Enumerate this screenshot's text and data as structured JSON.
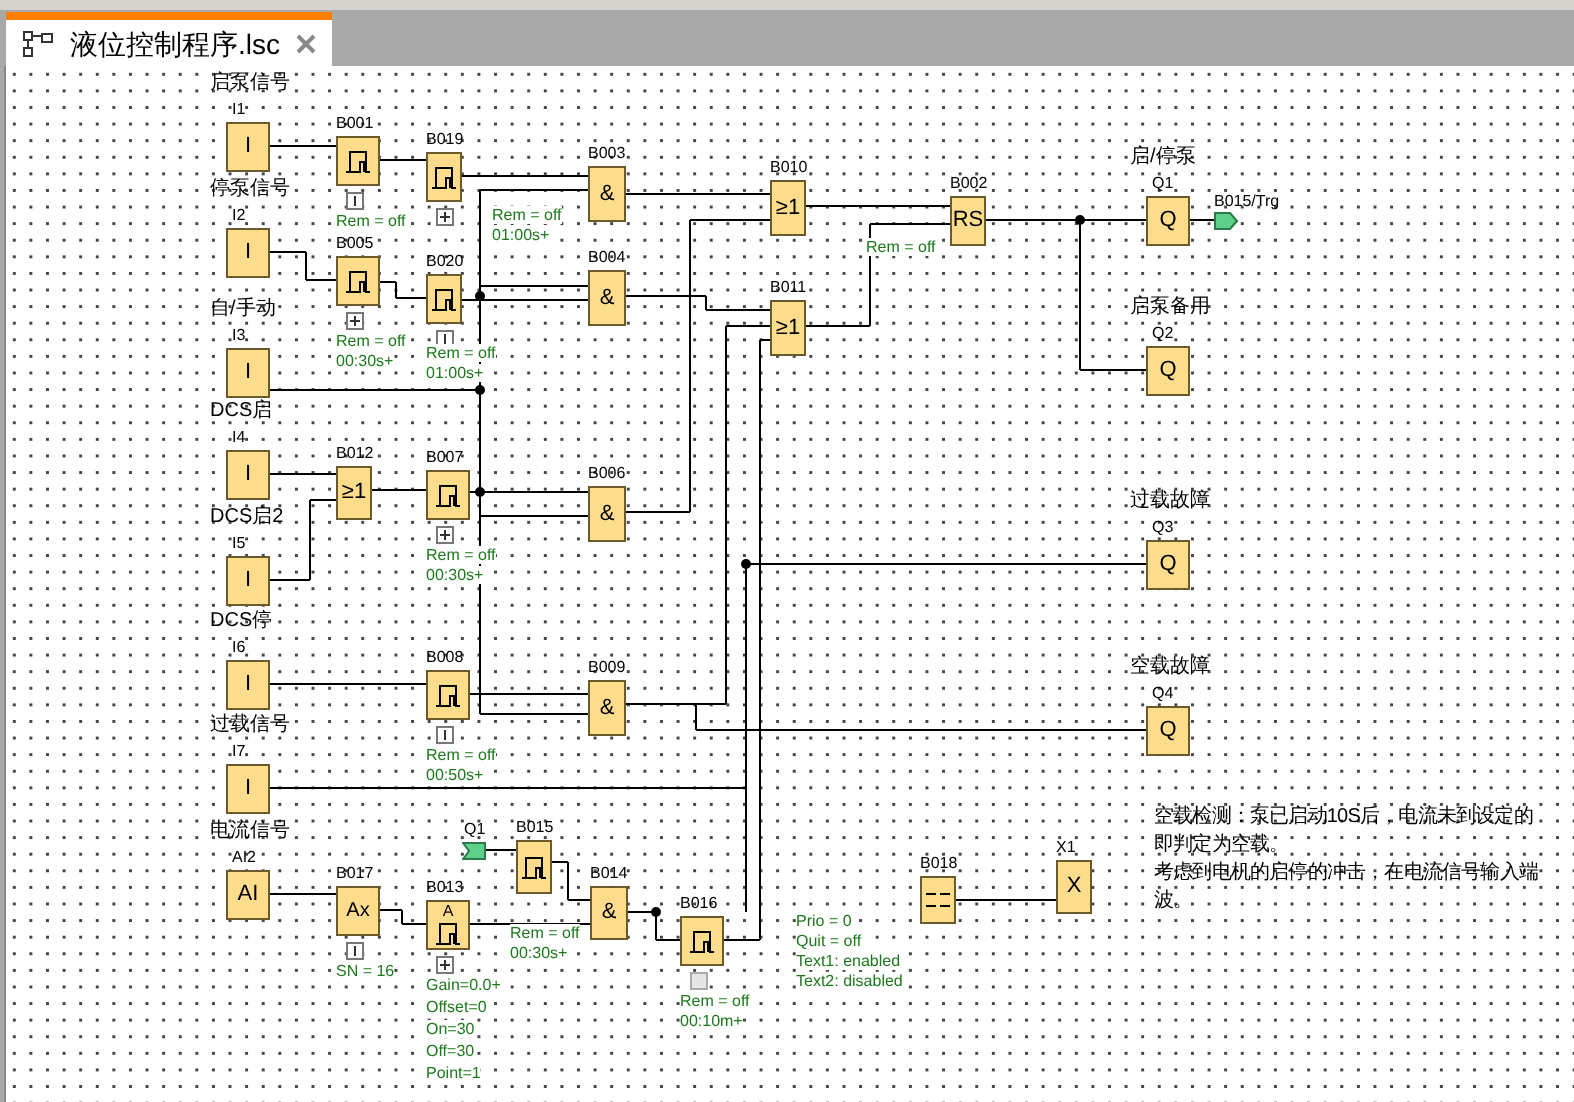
{
  "tab": {
    "title": "液位控制程序.lsc"
  },
  "blocks": [
    {
      "kind": "input",
      "id": "I1",
      "caption": "启泵信号",
      "symbol": "I"
    },
    {
      "kind": "input",
      "id": "I2",
      "caption": "停泵信号",
      "symbol": "I"
    },
    {
      "kind": "input",
      "id": "I3",
      "caption": "自/手动",
      "symbol": "I"
    },
    {
      "kind": "input",
      "id": "I4",
      "caption": "DCS启",
      "symbol": "I"
    },
    {
      "kind": "input",
      "id": "I5",
      "caption": "DCS启2",
      "symbol": "I"
    },
    {
      "kind": "input",
      "id": "I6",
      "caption": "DCS停",
      "symbol": "I"
    },
    {
      "kind": "input",
      "id": "I7",
      "caption": "过载信号",
      "symbol": "I"
    },
    {
      "kind": "input",
      "id": "AI2",
      "caption": "电流信号",
      "symbol": "AI"
    },
    {
      "kind": "timer",
      "id": "B001",
      "expanded": false,
      "toggle_disabled": false,
      "params": [
        "Rem = off"
      ]
    },
    {
      "kind": "timer",
      "id": "B005",
      "expanded": true,
      "toggle_disabled": false,
      "params": [
        "Rem = off",
        "00:30s+"
      ]
    },
    {
      "kind": "gate",
      "id": "B012",
      "symbol": "≥1"
    },
    {
      "kind": "amplifier",
      "id": "B017",
      "symbol": "Ax",
      "expanded": false,
      "toggle_disabled": false,
      "params": [
        "SN = 16"
      ]
    },
    {
      "kind": "timer",
      "id": "B019",
      "expanded": true,
      "toggle_disabled": false,
      "params": [
        "Rem = off",
        "01:00s+"
      ]
    },
    {
      "kind": "timer",
      "id": "B020",
      "expanded": false,
      "toggle_disabled": false,
      "params": [
        "Rem = off",
        "01:00s+"
      ]
    },
    {
      "kind": "timer",
      "id": "B007",
      "expanded": true,
      "toggle_disabled": false,
      "params": [
        "Rem = off",
        "00:30s+"
      ]
    },
    {
      "kind": "timer",
      "id": "B008",
      "expanded": false,
      "toggle_disabled": false,
      "params": [
        "Rem = off",
        "00:50s+"
      ]
    },
    {
      "kind": "threshold",
      "id": "B013",
      "symbol": "A",
      "expanded": true,
      "toggle_disabled": false,
      "params": [
        "Gain=0.0+",
        "Offset=0",
        "On=30",
        "Off=30",
        "Point=1"
      ]
    },
    {
      "kind": "timer",
      "id": "B015",
      "params": [
        "Rem = off",
        "00:30s+"
      ]
    },
    {
      "kind": "gate",
      "id": "B003",
      "symbol": "&"
    },
    {
      "kind": "gate",
      "id": "B004",
      "symbol": "&"
    },
    {
      "kind": "gate",
      "id": "B006",
      "symbol": "&"
    },
    {
      "kind": "gate",
      "id": "B009",
      "symbol": "&"
    },
    {
      "kind": "gate",
      "id": "B014",
      "symbol": "&"
    },
    {
      "kind": "timer",
      "id": "B016",
      "expanded": true,
      "toggle_disabled": true,
      "params": [
        "Rem = off",
        "00:10m+"
      ]
    },
    {
      "kind": "gate",
      "id": "B010",
      "symbol": "≥1"
    },
    {
      "kind": "gate",
      "id": "B011",
      "symbol": "≥1"
    },
    {
      "kind": "gate",
      "id": "B002",
      "symbol": "RS",
      "params": [
        "Rem = off"
      ]
    },
    {
      "kind": "message",
      "id": "B018",
      "params": [
        "Prio = 0",
        "Quit = off",
        "Text1: enabled",
        "Text2: disabled"
      ]
    },
    {
      "kind": "gate",
      "id": "X1",
      "symbol": "X"
    },
    {
      "kind": "output",
      "id": "Q1",
      "caption": "启/停泵",
      "symbol": "Q"
    },
    {
      "kind": "output",
      "id": "Q2",
      "caption": "启泵备用",
      "symbol": "Q"
    },
    {
      "kind": "output",
      "id": "Q3",
      "caption": "过载故障",
      "symbol": "Q"
    },
    {
      "kind": "output",
      "id": "Q4",
      "caption": "空载故障",
      "symbol": "Q"
    }
  ],
  "connectors": [
    {
      "label": "Q1"
    },
    {
      "label": "B015/Trg"
    }
  ],
  "note": {
    "lines": [
      "空载检测：泵已启动10S后，电流未到设定的",
      "即判定为空载。",
      "考虑到电机的启停的冲击，在电流信号输入端",
      "波。"
    ]
  }
}
